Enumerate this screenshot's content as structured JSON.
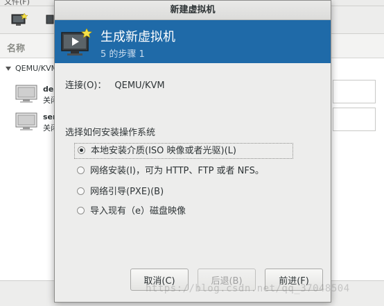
{
  "background": {
    "menubar_text": "文件(F)",
    "column_name": "名称",
    "group": "QEMU/KVM",
    "vms": [
      {
        "name": "de",
        "state": "关闭"
      },
      {
        "name": "ser",
        "state": "关闭"
      }
    ]
  },
  "dialog": {
    "window_title": "新建虚拟机",
    "banner": {
      "title": "生成新虚拟机",
      "step": "5 的步骤 1"
    },
    "connection_label": "连接(O)：",
    "connection_value": "QEMU/KVM",
    "question": "选择如何安装操作系统",
    "options": [
      {
        "label": "本地安装介质(ISO 映像或者光驱)(L)",
        "selected": true
      },
      {
        "label": "网络安装(I)，可为 HTTP、FTP 或者 NFS。",
        "selected": false
      },
      {
        "label": "网络引导(PXE)(B)",
        "selected": false
      },
      {
        "label": "导入现有（e）磁盘映像",
        "selected": false
      }
    ],
    "buttons": {
      "cancel": "取消(C)",
      "back": "后退(B)",
      "next": "前进(F)"
    }
  },
  "watermark": "https://blog.csdn.net/qq_37048504",
  "colors": {
    "banner": "#1f6aa8",
    "accent_star": "#f5e14a"
  }
}
